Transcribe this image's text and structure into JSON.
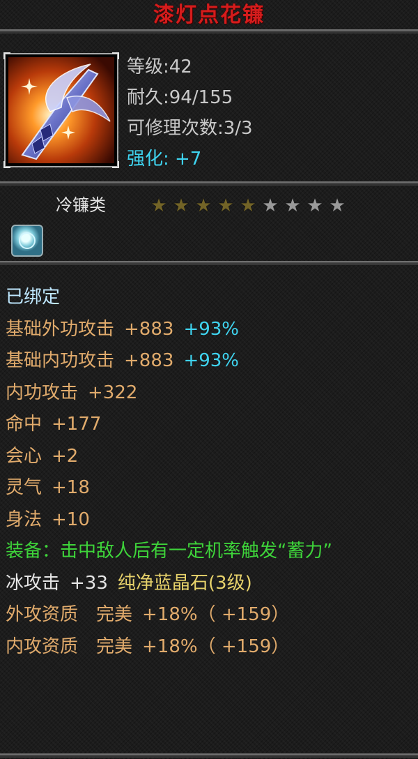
{
  "item": {
    "name": "漆灯点花镰",
    "icon": "scythe-weapon-icon",
    "level": "等级:42",
    "durability": "耐久:94/155",
    "repair": "可修理次数:3/3",
    "enhance": "强化: +7"
  },
  "rating": {
    "category": "冷镰类",
    "stars_total": 9,
    "stars_filled": 5
  },
  "gem_slot_icon": "blue-gem-socket-icon",
  "attributes": {
    "bound": "已绑定",
    "base_outer": {
      "label": "基础外功攻击",
      "value": "+883",
      "pct": "+93%"
    },
    "base_inner": {
      "label": "基础内功攻击",
      "value": "+883",
      "pct": "+93%"
    },
    "inner_attack": {
      "label": "内功攻击",
      "value": "+322"
    },
    "hit": {
      "label": "命中",
      "value": "+177"
    },
    "crit": {
      "label": "会心",
      "value": "+2"
    },
    "spirit": {
      "label": "灵气",
      "value": "+18"
    },
    "agility": {
      "label": "身法",
      "value": "+10"
    },
    "equip_effect": "装备：击中敌人后有一定机率触发“蓄力”",
    "ice": {
      "label": "冰攻击",
      "value": "+33",
      "gem": "纯净蓝晶石(3级)"
    },
    "outer_quality": {
      "label": "外攻资质",
      "grade": "完美",
      "pct": "+18%",
      "bonus": "（ +159）"
    },
    "inner_quality": {
      "label": "内攻资质",
      "grade": "完美",
      "pct": "+18%",
      "bonus": "（ +159）"
    }
  },
  "colors": {
    "title": "#d41c1c",
    "enhance": "#3fd4f0",
    "percent": "#3fd4f0",
    "attribute": "#e1ab6c",
    "equip_effect": "#3ed43a",
    "gem": "#e7d26b"
  }
}
